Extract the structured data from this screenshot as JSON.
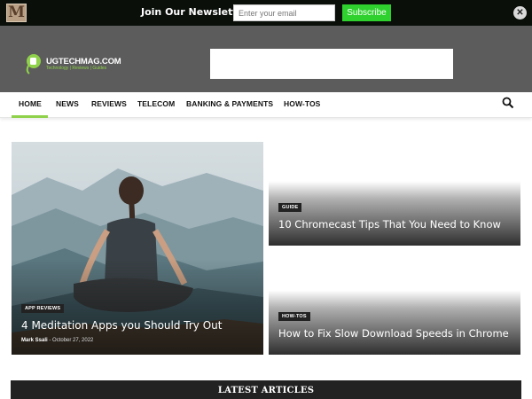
{
  "newsletter": {
    "logo_letter": "M",
    "title": "Join Our Newsletter",
    "email_placeholder": "Enter your email",
    "subscribe_label": "Subscribe",
    "close_glyph": "✕"
  },
  "header": {
    "brand": "UGTECHMAG.COM",
    "tagline": "Technology | Reviews | Guides",
    "logo_icon": "ugtechmag-logo"
  },
  "nav": {
    "items": [
      "HOME",
      "NEWS",
      "REVIEWS",
      "TELECOM",
      "BANKING & PAYMENTS",
      "HOW-TOS"
    ],
    "active": "HOME",
    "search_icon": "search-icon"
  },
  "featured": {
    "category": "APP REVIEWS",
    "title": "4 Meditation Apps you Should Try Out",
    "author": "Mark Ssali",
    "separator": "-",
    "date": "October 27, 2022"
  },
  "side_posts": [
    {
      "category": "GUIDE",
      "title": "10 Chromecast Tips That You Need to Know"
    },
    {
      "category": "HOW-TOS",
      "title": "How to Fix Slow Download Speeds in Chrome"
    }
  ],
  "latest": {
    "title": "LATEST ARTICLES"
  },
  "colors": {
    "accent_green": "#8fd14a",
    "subscribe_green": "#2fd12f",
    "header_gray": "#5c5c5c",
    "topbar": "#0a0f0a"
  }
}
